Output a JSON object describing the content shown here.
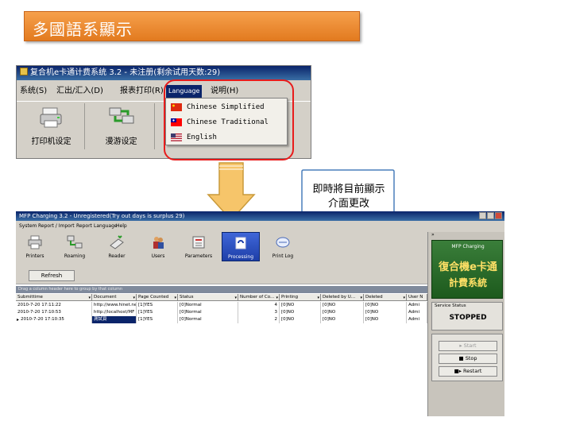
{
  "slide": {
    "title": "多國語系顯示"
  },
  "callout": {
    "text": "即時將目前顯示介面更改"
  },
  "top_app": {
    "title": "复合机e卡通计费系统 3.2 - 未注册(剩余试用天数:29)",
    "menu": [
      "系统(S)",
      "汇出/汇入(D)",
      "报表打印(R)",
      "Language",
      "说明(H)"
    ],
    "toolbar": [
      {
        "label": "打印机设定",
        "icon": "printer-icon"
      },
      {
        "label": "漫游设定",
        "icon": "roaming-icon"
      }
    ],
    "language_menu": [
      {
        "label": "Chinese Simplified",
        "flag": "cn-flag-icon"
      },
      {
        "label": "Chinese Traditional",
        "flag": "tw-flag-icon"
      },
      {
        "label": "English",
        "flag": "us-flag-icon"
      }
    ]
  },
  "bot_app": {
    "title": "MFP Charging 3.2 - Unregistered(Try out days is surplus 29)",
    "menu": [
      "System",
      "Report / Import",
      "Report",
      "Language",
      "Help"
    ],
    "toolbar": [
      {
        "label": "Printers",
        "icon": "printer-icon"
      },
      {
        "label": "Roaming",
        "icon": "roaming-icon"
      },
      {
        "label": "Reader",
        "icon": "reader-icon"
      },
      {
        "label": "Users",
        "icon": "users-icon"
      },
      {
        "label": "Parameters",
        "icon": "parameters-icon"
      },
      {
        "label": "Processing",
        "icon": "processing-icon"
      },
      {
        "label": "Print Log",
        "icon": "print-log-icon"
      }
    ],
    "refresh_label": "Refresh",
    "group_hint": "Drag a column header here to group by that column",
    "grid": {
      "headers": [
        "Submittime",
        "Document",
        "Page Counted",
        "Status",
        "Number of Co...",
        "Printing",
        "Deleted by U...",
        "Deleted",
        "User N"
      ],
      "rows": [
        [
          "2010-7-20 17:11:22",
          "http://www.hinet.ne",
          "[1]YES",
          "[0]Normal",
          "4",
          "[0]NO",
          "[0]NO",
          "[0]NO",
          "Admi"
        ],
        [
          "2010-7-20 17:10:53",
          "http://localhost/MF",
          "[1]YES",
          "[0]Normal",
          "3",
          "[0]NO",
          "[0]NO",
          "[0]NO",
          "Admi"
        ],
        [
          "2010-7-20 17:10:35",
          "測試頁",
          "[1]YES",
          "[0]Normal",
          "2",
          "[0]NO",
          "[0]NO",
          "[0]NO",
          "Admi"
        ]
      ]
    },
    "side": {
      "collapse": "»",
      "logo_top": "MFP Charging",
      "logo_main": "復合機e卡通",
      "logo_sub": "計費系統",
      "service_label": "Service Status",
      "service_status": "STOPPED",
      "start": "Start",
      "stop": "Stop",
      "restart": "Restart"
    }
  },
  "colors": {
    "highlight": "#e81c1c",
    "title_bar": "#e27a1f",
    "arrow": "#f6c56a"
  }
}
